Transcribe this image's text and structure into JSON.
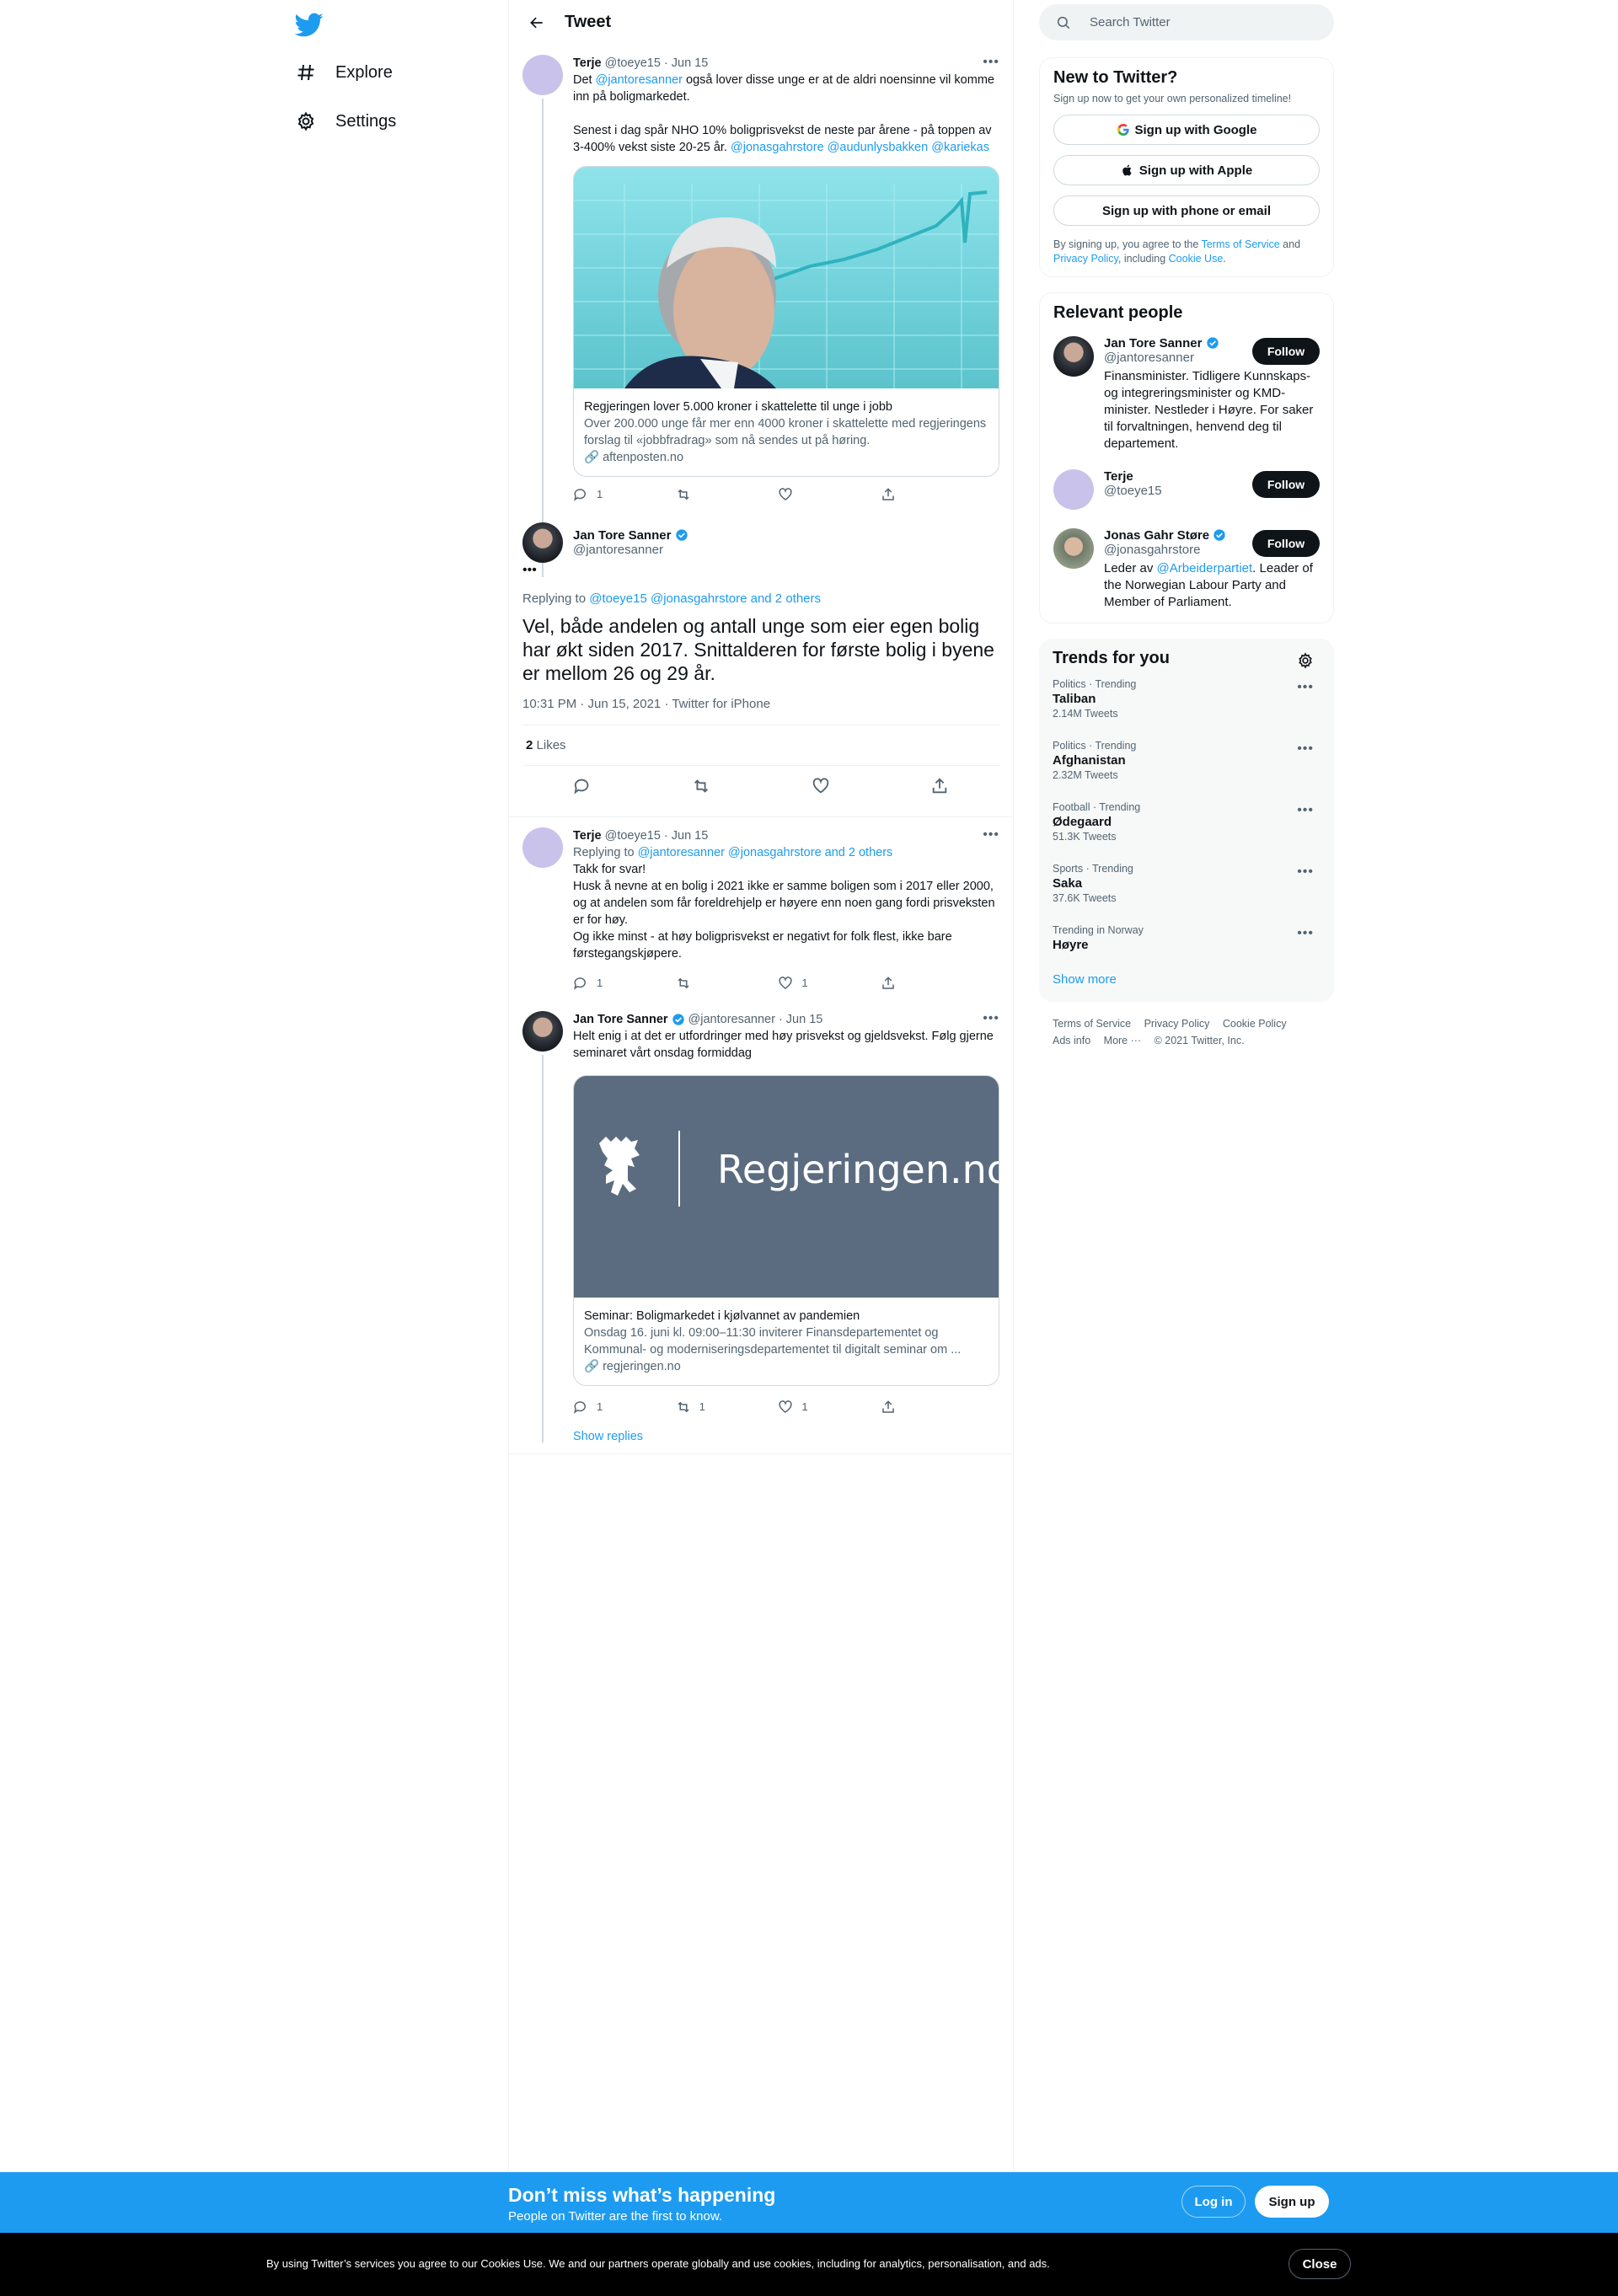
{
  "nav": {
    "explore": "Explore",
    "settings": "Settings"
  },
  "header": {
    "title": "Tweet"
  },
  "tweet1": {
    "name": "Terje",
    "handle": "@toeye15",
    "sep": "·",
    "date": "Jun 15",
    "text_a": "Det",
    "mention_a": "@jantoresanner",
    "text_b": "også lover disse unge er at de aldri noensinne vil komme inn på boligmarkedet.",
    "text_c": "Senest i dag spår NHO 10% boligprisvekst de neste par årene - på toppen av 3-400% vekst siste 20-25 år.",
    "mention_b": "@jonasgahrstore",
    "mention_c": "@audunlysbakken",
    "mention_d": "@kariekas",
    "card": {
      "title": "Regjeringen lover 5.000 kroner i skattelette til unge i jobb",
      "desc": "Over 200.000 unge får mer enn 4000 kroner i skattelette med regjeringens forslag til «jobbfradrag» som nå sendes ut på høring.",
      "link": "aftenposten.no"
    },
    "replies": "1",
    "retweets": "",
    "likes": ""
  },
  "focal": {
    "name": "Jan Tore Sanner",
    "handle": "@jantoresanner",
    "replying_prefix": "Replying to",
    "replying_to": "@toeye15 @jonasgahrstore and 2 others",
    "text": "Vel, både andelen og antall unge som eier egen bolig har økt siden 2017. Snittalderen for første bolig i byene er mellom 26 og 29 år.",
    "date": "10:31 PM · Jun 15, 2021 · Twitter for iPhone",
    "likes_count": "2",
    "likes_label": "Likes"
  },
  "tweet2": {
    "name": "Terje",
    "handle": "@toeye15",
    "sep": "·",
    "date": "Jun 15",
    "replying_prefix": "Replying to",
    "replying_to": "@jantoresanner @jonasgahrstore and 2 others",
    "line1": "Takk for svar!",
    "line2": "Husk å nevne at en bolig i 2021 ikke er samme boligen som i 2017 eller 2000, og at andelen som får foreldrehjelp er høyere enn noen gang fordi prisveksten er for høy.",
    "line3": "Og ikke minst - at høy boligprisvekst er negativt for folk flest, ikke bare førstegangskjøpere.",
    "replies": "1",
    "retweets": "",
    "likes": "1"
  },
  "tweet3": {
    "name": "Jan Tore Sanner",
    "handle": "@jantoresanner",
    "sep": "·",
    "date": "Jun 15",
    "text": "Helt enig i at det er utfordringer med høy prisvekst og gjeldsvekst. Følg gjerne seminaret vårt onsdag formiddag",
    "card": {
      "brand": "Regjeringen.no",
      "title": "Seminar: Boligmarkedet i kjølvannet av pandemien",
      "desc": "Onsdag 16. juni kl. 09:00–11:30 inviterer Finansdepartementet og Kommunal- og moderniseringsdepartementet til digitalt seminar om ...",
      "link": "regjeringen.no"
    },
    "replies": "1",
    "retweets": "1",
    "likes": "1",
    "show_replies": "Show replies"
  },
  "search": {
    "placeholder": "Search Twitter"
  },
  "new_to_twitter": {
    "title": "New to Twitter?",
    "subtitle": "Sign up now to get your own personalized timeline!",
    "google": "Sign up with Google",
    "apple": "Sign up with Apple",
    "phone": "Sign up with phone or email",
    "legal_a": "By signing up, you agree to the",
    "terms": "Terms of Service",
    "legal_b": "and",
    "privacy": "Privacy Policy",
    "legal_c": ", including",
    "cookie": "Cookie Use",
    "legal_d": "."
  },
  "relevant": {
    "title": "Relevant people",
    "follow": "Follow",
    "people": [
      {
        "name": "Jan Tore Sanner",
        "handle": "@jantoresanner",
        "bio": "Finansminister. Tidligere Kunnskaps- og integreringsminister og KMD-minister. Nestleder i Høyre. For saker til forvaltningen, henvend deg til departement."
      },
      {
        "name": "Terje",
        "handle": "@toeye15",
        "bio": ""
      },
      {
        "name": "Jonas Gahr Støre",
        "handle": "@jonasgahrstore",
        "bio_a": "Leder av",
        "bio_mention": "@Arbeiderpartiet",
        "bio_b": ". Leader of the Norwegian Labour Party and Member of Parliament."
      }
    ]
  },
  "trends": {
    "title": "Trends for you",
    "items": [
      {
        "meta": "Politics · Trending",
        "name": "Taliban",
        "count": "2.14M Tweets"
      },
      {
        "meta": "Politics · Trending",
        "name": "Afghanistan",
        "count": "2.32M Tweets"
      },
      {
        "meta": "Football · Trending",
        "name": "Ødegaard",
        "count": "51.3K Tweets"
      },
      {
        "meta": "Sports · Trending",
        "name": "Saka",
        "count": "37.6K Tweets"
      },
      {
        "meta": "Trending in Norway",
        "name": "Høyre",
        "count": ""
      }
    ],
    "show_more": "Show more"
  },
  "footer": {
    "terms": "Terms of Service",
    "privacy": "Privacy Policy",
    "cookie": "Cookie Policy",
    "ads": "Ads info",
    "more": "More ···",
    "copyright": "© 2021 Twitter, Inc."
  },
  "bottombar": {
    "title": "Don’t miss what’s happening",
    "subtitle": "People on Twitter are the first to know.",
    "login": "Log in",
    "signup": "Sign up"
  },
  "cookiebar": {
    "text": "By using Twitter’s services you agree to our Cookies Use. We and our partners operate globally and use cookies, including for analytics, personalisation, and ads.",
    "close": "Close"
  },
  "colors": {
    "accent": "#1d9bf0",
    "text": "#0f1419",
    "muted": "#536471"
  },
  "icons": [
    "twitter-bird-icon",
    "hashtag-icon",
    "gear-icon",
    "back-arrow-icon",
    "more-icon",
    "verified-badge-icon",
    "reply-icon",
    "retweet-icon",
    "like-icon",
    "share-icon",
    "search-icon",
    "google-icon",
    "apple-icon",
    "link-icon"
  ]
}
